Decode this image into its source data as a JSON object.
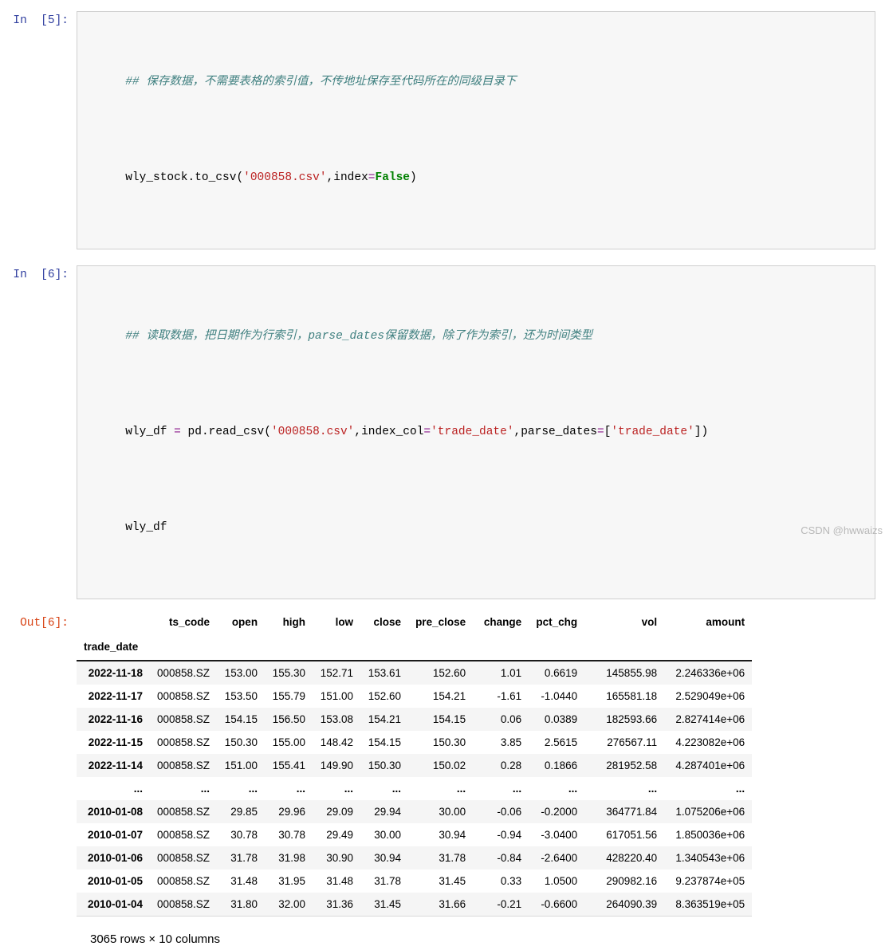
{
  "cells": [
    {
      "prompt": "In  [5]:",
      "lines": [
        [
          {
            "t": "comment",
            "v": "## 保存数据，不需要表格的索引值，不传地址保存至代码所在的同级目录下"
          }
        ],
        [
          {
            "t": "plain",
            "v": "wly_stock.to_csv("
          },
          {
            "t": "str",
            "v": "'000858.csv'"
          },
          {
            "t": "plain",
            "v": ",index"
          },
          {
            "t": "op",
            "v": "="
          },
          {
            "t": "kw",
            "v": "False"
          },
          {
            "t": "plain",
            "v": ")"
          }
        ]
      ]
    },
    {
      "prompt": "In  [6]:",
      "lines": [
        [
          {
            "t": "comment",
            "v": "## 读取数据，把日期作为行索引，parse_dates保留数据，除了作为索引，还为时间类型"
          }
        ],
        [
          {
            "t": "plain",
            "v": "wly_df "
          },
          {
            "t": "op",
            "v": "="
          },
          {
            "t": "plain",
            "v": " pd.read_csv("
          },
          {
            "t": "str",
            "v": "'000858.csv'"
          },
          {
            "t": "plain",
            "v": ",index_col"
          },
          {
            "t": "op",
            "v": "="
          },
          {
            "t": "str",
            "v": "'trade_date'"
          },
          {
            "t": "plain",
            "v": ",parse_dates"
          },
          {
            "t": "op",
            "v": "="
          },
          {
            "t": "plain",
            "v": "["
          },
          {
            "t": "str",
            "v": "'trade_date'"
          },
          {
            "t": "plain",
            "v": "])"
          }
        ],
        [
          {
            "t": "plain",
            "v": "wly_df"
          }
        ]
      ]
    }
  ],
  "output": {
    "prompt": "Out[6]:",
    "index_name": "trade_date",
    "columns": [
      "ts_code",
      "open",
      "high",
      "low",
      "close",
      "pre_close",
      "change",
      "pct_chg",
      "vol",
      "amount"
    ],
    "rows": [
      {
        "index": "2022-11-18",
        "cells": [
          "000858.SZ",
          "153.00",
          "155.30",
          "152.71",
          "153.61",
          "152.60",
          "1.01",
          "0.6619",
          "145855.98",
          "2.246336e+06"
        ]
      },
      {
        "index": "2022-11-17",
        "cells": [
          "000858.SZ",
          "153.50",
          "155.79",
          "151.00",
          "152.60",
          "154.21",
          "-1.61",
          "-1.0440",
          "165581.18",
          "2.529049e+06"
        ]
      },
      {
        "index": "2022-11-16",
        "cells": [
          "000858.SZ",
          "154.15",
          "156.50",
          "153.08",
          "154.21",
          "154.15",
          "0.06",
          "0.0389",
          "182593.66",
          "2.827414e+06"
        ]
      },
      {
        "index": "2022-11-15",
        "cells": [
          "000858.SZ",
          "150.30",
          "155.00",
          "148.42",
          "154.15",
          "150.30",
          "3.85",
          "2.5615",
          "276567.11",
          "4.223082e+06"
        ]
      },
      {
        "index": "2022-11-14",
        "cells": [
          "000858.SZ",
          "151.00",
          "155.41",
          "149.90",
          "150.30",
          "150.02",
          "0.28",
          "0.1866",
          "281952.58",
          "4.287401e+06"
        ]
      },
      {
        "index": "...",
        "ellipsis": true,
        "cells": [
          "...",
          "...",
          "...",
          "...",
          "...",
          "...",
          "...",
          "...",
          "...",
          "..."
        ]
      },
      {
        "index": "2010-01-08",
        "cells": [
          "000858.SZ",
          "29.85",
          "29.96",
          "29.09",
          "29.94",
          "30.00",
          "-0.06",
          "-0.2000",
          "364771.84",
          "1.075206e+06"
        ]
      },
      {
        "index": "2010-01-07",
        "cells": [
          "000858.SZ",
          "30.78",
          "30.78",
          "29.49",
          "30.00",
          "30.94",
          "-0.94",
          "-3.0400",
          "617051.56",
          "1.850036e+06"
        ]
      },
      {
        "index": "2010-01-06",
        "cells": [
          "000858.SZ",
          "31.78",
          "31.98",
          "30.90",
          "30.94",
          "31.78",
          "-0.84",
          "-2.6400",
          "428220.40",
          "1.340543e+06"
        ]
      },
      {
        "index": "2010-01-05",
        "cells": [
          "000858.SZ",
          "31.48",
          "31.95",
          "31.48",
          "31.78",
          "31.45",
          "0.33",
          "1.0500",
          "290982.16",
          "9.237874e+05"
        ]
      },
      {
        "index": "2010-01-04",
        "cells": [
          "000858.SZ",
          "31.80",
          "32.00",
          "31.36",
          "31.45",
          "31.66",
          "-0.21",
          "-0.6600",
          "264090.39",
          "8.363519e+05"
        ]
      }
    ],
    "shape_text": "3065 rows × 10 columns"
  },
  "watermark": "CSDN @hwwaizs",
  "colors": {
    "prompt_in": "#303f9f",
    "prompt_out": "#d84315",
    "comment": "#408080",
    "string": "#bb2222",
    "operator": "#8b1a8b",
    "keyword": "#008000",
    "stripe": "#f5f5f5",
    "cell_bg": "#f7f7f7",
    "cell_border": "#cfcfcf"
  }
}
